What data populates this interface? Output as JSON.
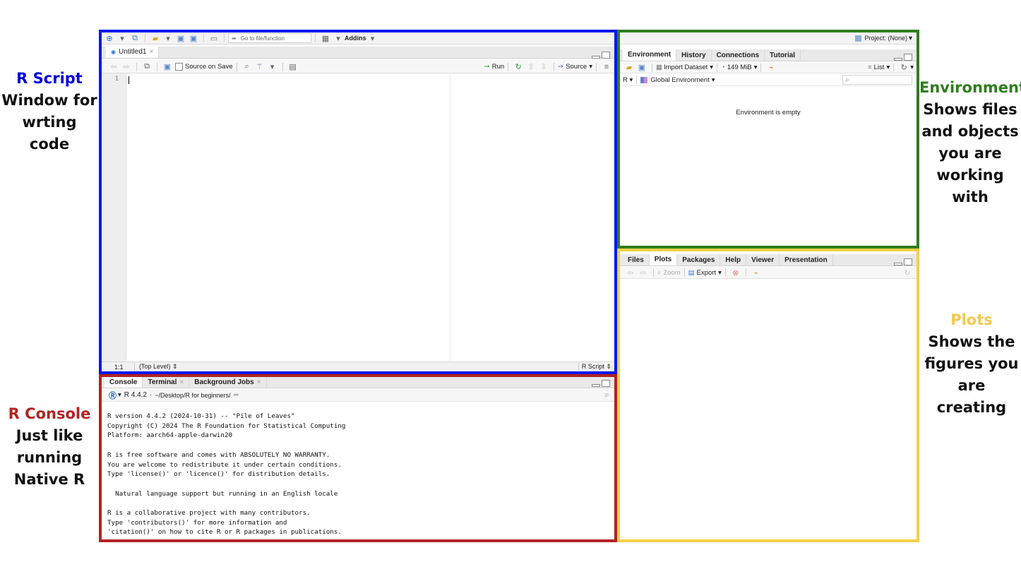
{
  "annotations": {
    "script": {
      "title": "R Script",
      "lines": [
        "Window for",
        "wrting code"
      ],
      "color": "#0000e0"
    },
    "console": {
      "title": "R Console",
      "lines": [
        "Just like",
        "running",
        "Native R"
      ],
      "color": "#b22222"
    },
    "environment": {
      "title": "Environment",
      "lines": [
        "Shows files",
        "and objects",
        "you are",
        "working with"
      ],
      "color": "#2e7d1e"
    },
    "plots": {
      "title": "Plots",
      "lines": [
        "Shows the",
        "figures you",
        "are creating"
      ],
      "color": "#f2c94c"
    }
  },
  "frame_colors": {
    "script": "#0018ee",
    "console": "#b22222",
    "environment": "#2f7d1f",
    "plots": "#f5cf4a"
  },
  "toolbar": {
    "goto_placeholder": "Go to file/function",
    "addins": "Addins"
  },
  "project": {
    "label": "Project: (None)"
  },
  "editor": {
    "tab": "Untitled1",
    "source_on_save": "Source on Save",
    "run": "Run",
    "source": "Source",
    "line_number": "1",
    "status_position": "1:1",
    "status_scope": "(Top Level)",
    "status_type": "R Script"
  },
  "console": {
    "tabs": [
      "Console",
      "Terminal",
      "Background Jobs"
    ],
    "version_label": "R 4.4.2",
    "path": "~/Desktop/R for beginners/",
    "output": [
      "R version 4.4.2 (2024-10-31) -- \"Pile of Leaves\"",
      "Copyright (C) 2024 The R Foundation for Statistical Computing",
      "Platform: aarch64-apple-darwin20",
      "",
      "R is free software and comes with ABSOLUTELY NO WARRANTY.",
      "You are welcome to redistribute it under certain conditions.",
      "Type 'license()' or 'licence()' for distribution details.",
      "",
      "  Natural language support but running in an English locale",
      "",
      "R is a collaborative project with many contributors.",
      "Type 'contributors()' for more information and",
      "'citation()' on how to cite R or R packages in publications."
    ]
  },
  "environment": {
    "tabs": [
      "Environment",
      "History",
      "Connections",
      "Tutorial"
    ],
    "import_dataset": "Import Dataset",
    "memory": "149 MiB",
    "view": "List",
    "language": "R",
    "scope": "Global Environment",
    "empty_message": "Environment is empty"
  },
  "files": {
    "tabs": [
      "Files",
      "Plots",
      "Packages",
      "Help",
      "Viewer",
      "Presentation"
    ],
    "zoom": "Zoom",
    "export": "Export"
  }
}
